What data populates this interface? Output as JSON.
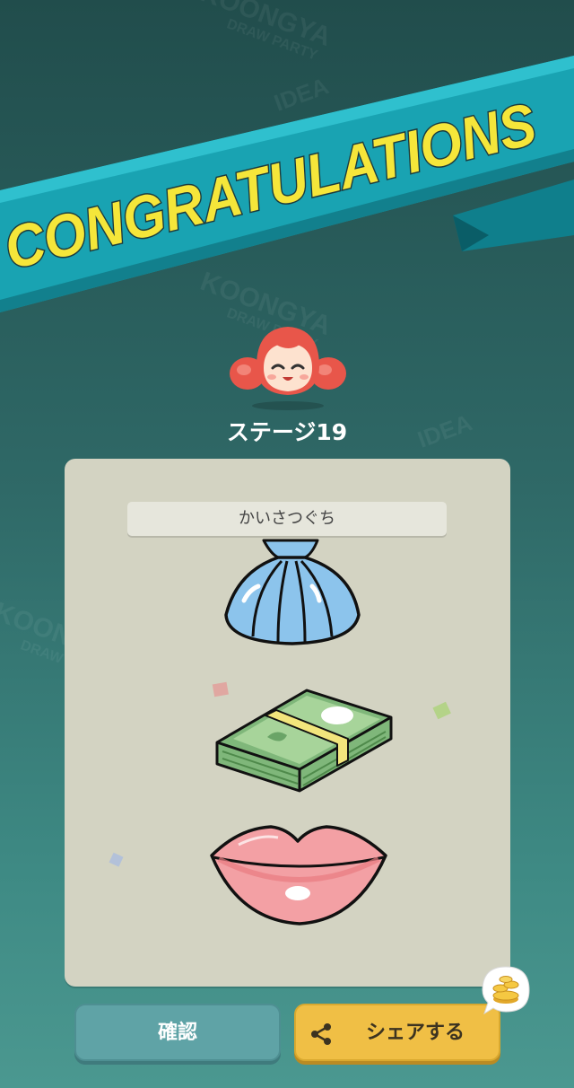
{
  "banner": {
    "title": "CONGRATULATIONS"
  },
  "stage": {
    "label": "ステージ19"
  },
  "quiz": {
    "word": "かいさつぐち"
  },
  "drawings": [
    "shell-icon",
    "money-bundle-icon",
    "lips-icon"
  ],
  "buttons": {
    "confirm_label": "確認",
    "share_label": "シェアする"
  },
  "background": {
    "watermarks": [
      "KOONGYA",
      "DRAW PARTY",
      "IDEA",
      "KOONGYA",
      "DRAW PARTY",
      "IDEA",
      "KOONGYA",
      "DRAW PARTY",
      "IDEA"
    ]
  },
  "colors": {
    "banner_teal": "#1aa6b5",
    "title_yellow": "#f5e63a",
    "confirm": "#5fa3a6",
    "share": "#f0bf45"
  }
}
